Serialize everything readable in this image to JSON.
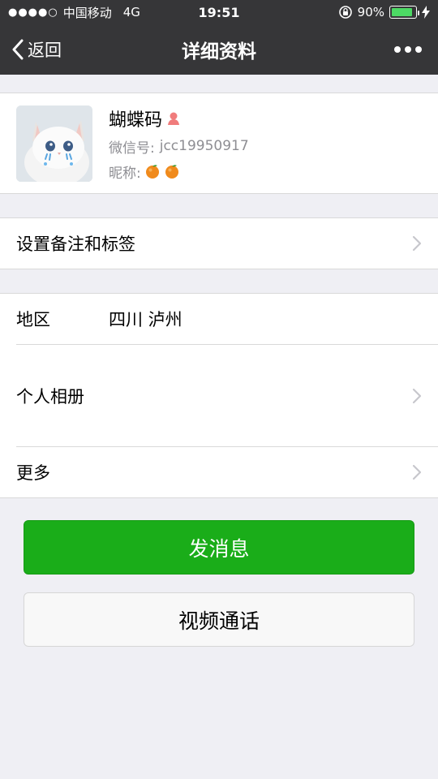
{
  "status_bar": {
    "signal": "●●●●○",
    "carrier": "中国移动",
    "network": "4G",
    "time": "19:51",
    "battery_percent": "90%",
    "battery_level": 0.9
  },
  "nav": {
    "back_label": "返回",
    "title": "详细资料"
  },
  "profile": {
    "name": "蝴蝶码",
    "wechat_id_label": "微信号:",
    "wechat_id": "jcc19950917",
    "nickname_label": "昵称:"
  },
  "cells": {
    "remark_tag": "设置备注和标签",
    "region_label": "地区",
    "region_value": "四川 泸州",
    "album": "个人相册",
    "more": "更多"
  },
  "buttons": {
    "send_message": "发消息",
    "video_call": "视频通话"
  },
  "colors": {
    "nav_bg": "#363638",
    "primary_green": "#1aad19",
    "page_bg": "#efeff4"
  }
}
